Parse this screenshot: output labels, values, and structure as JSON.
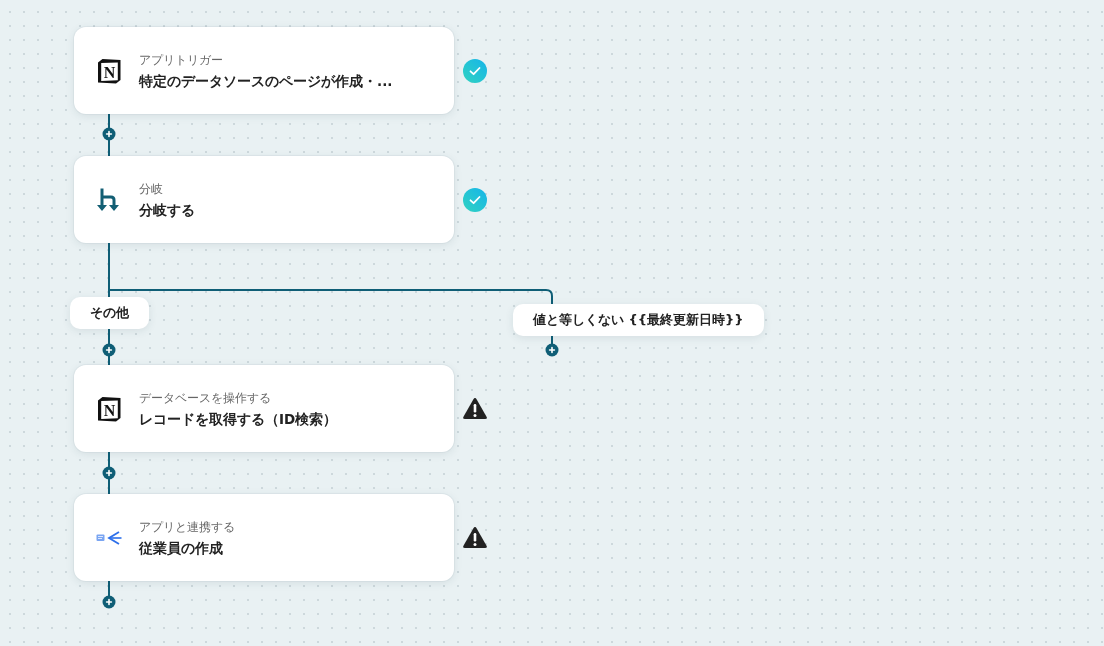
{
  "flow": {
    "steps": [
      {
        "icon": {
          "kind": "cube",
          "letter": "N"
        },
        "category": "アプリトリガー",
        "title": "特定のデータソースのページが作成・...",
        "complete": true
      },
      {
        "icon": {
          "kind": "fork"
        },
        "category": "分岐",
        "title": "分岐する",
        "complete": true
      }
    ],
    "branches": [
      {
        "label": "その他",
        "steps": [
          {
            "icon": {
              "kind": "cube",
              "letter": "N"
            },
            "category": "データベースを操作する",
            "title": "レコードを取得する（ID検索）",
            "complete": false
          },
          {
            "icon": {
              "kind": "chevron"
            },
            "category": "アプリと連携する",
            "title": "従業員の作成",
            "complete": false
          }
        ]
      },
      {
        "label": "値と等しくない {{最終更新日時}}"
      }
    ]
  }
}
